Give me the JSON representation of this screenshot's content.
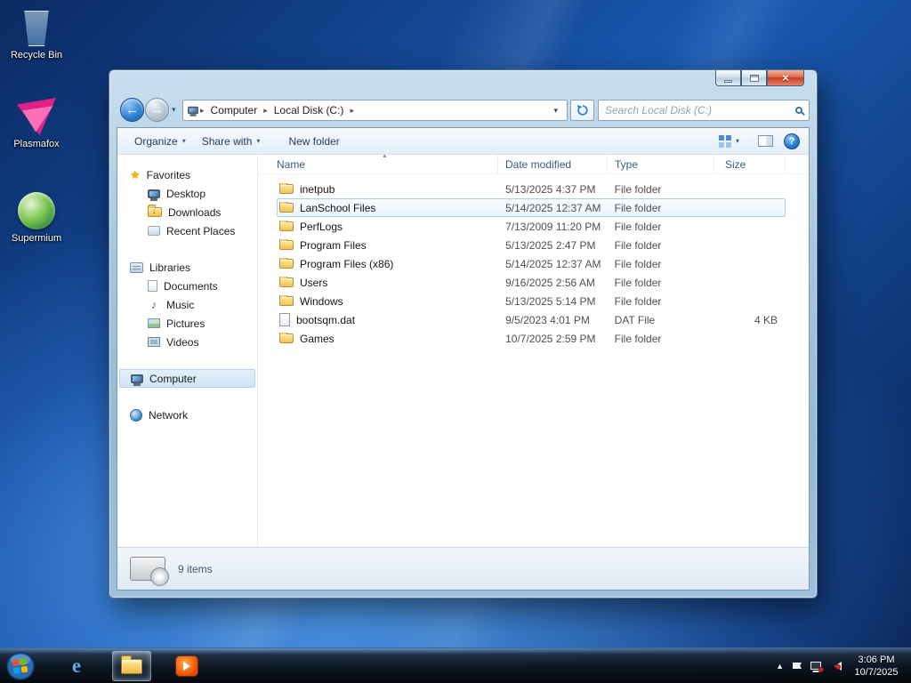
{
  "glyphs": {
    "caret_down": "▾",
    "crumb_sep": "▸",
    "sort_asc": "▲",
    "back_arrow": "←",
    "forward_arrow": "→",
    "close": "×",
    "help": "?",
    "star": "★",
    "music_note": "♪",
    "tray_expand": "▲",
    "ie_logo": "e"
  },
  "desktop": {
    "icons": [
      {
        "label": "Recycle Bin"
      },
      {
        "label": "Plasmafox"
      },
      {
        "label": "Supermium"
      }
    ]
  },
  "explorer": {
    "breadcrumb": {
      "root": "Computer",
      "current": "Local Disk (C:)"
    },
    "search_placeholder": "Search Local Disk (C:)",
    "toolbar": {
      "organize": "Organize",
      "share_with": "Share with",
      "new_folder": "New folder"
    },
    "sidebar": {
      "favorites_label": "Favorites",
      "favorites": [
        "Desktop",
        "Downloads",
        "Recent Places"
      ],
      "libraries_label": "Libraries",
      "libraries": [
        "Documents",
        "Music",
        "Pictures",
        "Videos"
      ],
      "computer_label": "Computer",
      "network_label": "Network"
    },
    "columns": {
      "name": "Name",
      "modified": "Date modified",
      "type": "Type",
      "size": "Size"
    },
    "rows": [
      {
        "name": "inetpub",
        "modified": "5/13/2025 4:37 PM",
        "type": "File folder",
        "size": ""
      },
      {
        "name": "LanSchool Files",
        "modified": "5/14/2025 12:37 AM",
        "type": "File folder",
        "size": ""
      },
      {
        "name": "PerfLogs",
        "modified": "7/13/2009 11:20 PM",
        "type": "File folder",
        "size": ""
      },
      {
        "name": "Program Files",
        "modified": "5/13/2025 2:47 PM",
        "type": "File folder",
        "size": ""
      },
      {
        "name": "Program Files (x86)",
        "modified": "5/14/2025 12:37 AM",
        "type": "File folder",
        "size": ""
      },
      {
        "name": "Users",
        "modified": "9/16/2025 2:56 AM",
        "type": "File folder",
        "size": ""
      },
      {
        "name": "Windows",
        "modified": "5/13/2025 5:14 PM",
        "type": "File folder",
        "size": ""
      },
      {
        "name": "bootsqm.dat",
        "modified": "9/5/2023 4:01 PM",
        "type": "DAT File",
        "size": "4 KB"
      },
      {
        "name": "Games",
        "modified": "10/7/2025 2:59 PM",
        "type": "File folder",
        "size": ""
      }
    ],
    "status": {
      "item_count": "9 items"
    }
  },
  "taskbar": {
    "clock": {
      "time": "3:06 PM",
      "date": "10/7/2025"
    }
  },
  "colors": {
    "selection_border": "#a9d1ee",
    "selection_fill": "#eaf4fc",
    "accent_blue": "#2a7fd4"
  }
}
